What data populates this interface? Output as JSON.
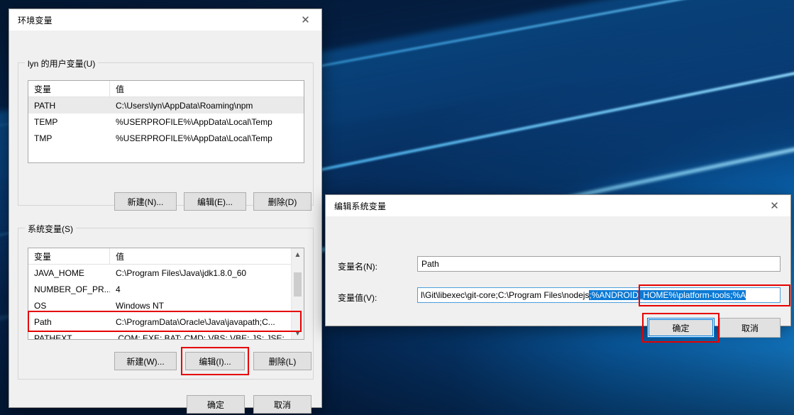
{
  "env_dialog": {
    "title": "环境变量",
    "close_icon": "✕",
    "user_group": {
      "legend": "lyn 的用户变量(U)",
      "columns": [
        "变量",
        "值"
      ],
      "rows": [
        {
          "name": "PATH",
          "value": "C:\\Users\\lyn\\AppData\\Roaming\\npm",
          "selected": true
        },
        {
          "name": "TEMP",
          "value": "%USERPROFILE%\\AppData\\Local\\Temp",
          "selected": false
        },
        {
          "name": "TMP",
          "value": "%USERPROFILE%\\AppData\\Local\\Temp",
          "selected": false
        }
      ],
      "buttons": {
        "new": "新建(N)...",
        "edit": "编辑(E)...",
        "delete": "删除(D)"
      }
    },
    "system_group": {
      "legend": "系统变量(S)",
      "columns": [
        "变量",
        "值"
      ],
      "rows": [
        {
          "name": "JAVA_HOME",
          "value": "C:\\Program Files\\Java\\jdk1.8.0_60",
          "highlight": false
        },
        {
          "name": "NUMBER_OF_PR...",
          "value": "4",
          "highlight": false
        },
        {
          "name": "OS",
          "value": "Windows NT",
          "highlight": false
        },
        {
          "name": "Path",
          "value": "C:\\ProgramData\\Oracle\\Java\\javapath;C...",
          "highlight": true
        },
        {
          "name": "PATHEXT",
          "value": ".COM;.EXE;.BAT;.CMD;.VBS;.VBE;.JS;.JSE;",
          "highlight": false
        }
      ],
      "buttons": {
        "new": "新建(W)...",
        "edit": "编辑(I)...",
        "delete": "删除(L)"
      },
      "scroll_up_icon": "▲",
      "scroll_down_icon": "▼"
    },
    "footer": {
      "ok": "确定",
      "cancel": "取消"
    }
  },
  "edit_dialog": {
    "title": "编辑系统变量",
    "close_icon": "✕",
    "name_label": "变量名(N):",
    "name_value": "Path",
    "value_label": "变量值(V):",
    "value_prefix": "l\\Git\\libexec\\git-core;C:\\Program Files\\nodejs",
    "value_selected": ";%ANDROID_HOME%\\platform-tools;%A",
    "buttons": {
      "ok": "确定",
      "cancel": "取消"
    }
  },
  "colors": {
    "accent_blue": "#0078d7",
    "selection_blue": "#0b7ad6",
    "annotation_red": "#e60000",
    "dialog_face": "#f0f0f0",
    "button_face": "#e1e1e1"
  }
}
